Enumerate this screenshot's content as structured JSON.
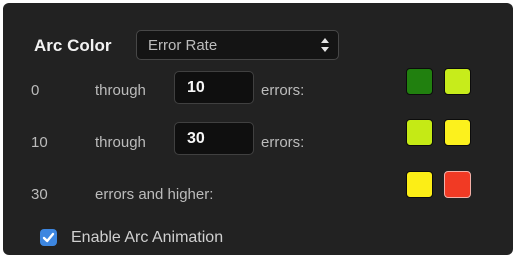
{
  "arc_color": {
    "label": "Arc Color",
    "selected": "Error Rate"
  },
  "rows": [
    {
      "start": "0",
      "through_label": "through",
      "end_value": "10",
      "suffix": "errors:",
      "swatches": [
        "#21800f",
        "#c7ec1b"
      ]
    },
    {
      "start": "10",
      "through_label": "through",
      "end_value": "30",
      "suffix": "errors:",
      "swatches": [
        "#c5ea15",
        "#fcf11d"
      ]
    },
    {
      "start": "30",
      "text": "errors and higher:",
      "swatches": [
        "#fcee16",
        "#f13a24"
      ]
    }
  ],
  "animation": {
    "label": "Enable Arc Animation",
    "checked": true
  }
}
